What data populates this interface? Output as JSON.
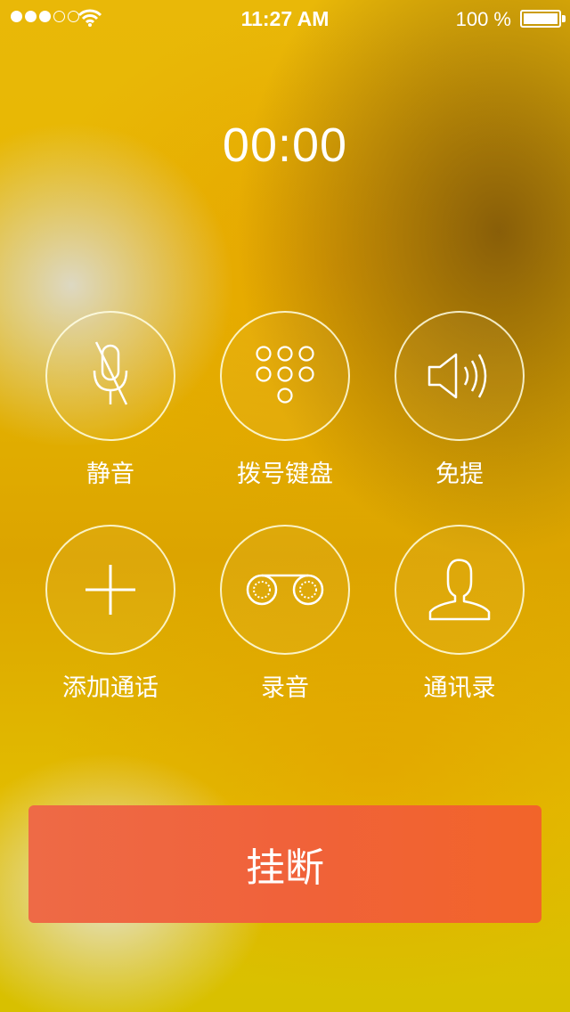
{
  "status_bar": {
    "time": "11:27 AM",
    "battery_percent": "100 %",
    "signal_strength": 3,
    "signal_max": 5,
    "icons": [
      "signal-dots-icon",
      "wifi-icon",
      "battery-icon"
    ]
  },
  "call": {
    "timer": "00:00"
  },
  "controls": [
    {
      "id": "mute",
      "label": "静音",
      "icon": "mic-muted-icon"
    },
    {
      "id": "keypad",
      "label": "拨号键盘",
      "icon": "keypad-icon"
    },
    {
      "id": "speaker",
      "label": "免提",
      "icon": "speaker-icon"
    },
    {
      "id": "add-call",
      "label": "添加通话",
      "icon": "plus-icon"
    },
    {
      "id": "record",
      "label": "录音",
      "icon": "tape-record-icon"
    },
    {
      "id": "contacts",
      "label": "通讯录",
      "icon": "contact-person-icon"
    }
  ],
  "hangup": {
    "label": "挂断",
    "color": "#f0623a"
  },
  "colors": {
    "background_accent": "#e6b700",
    "hangup": "#f0623a",
    "foreground": "#ffffff"
  }
}
